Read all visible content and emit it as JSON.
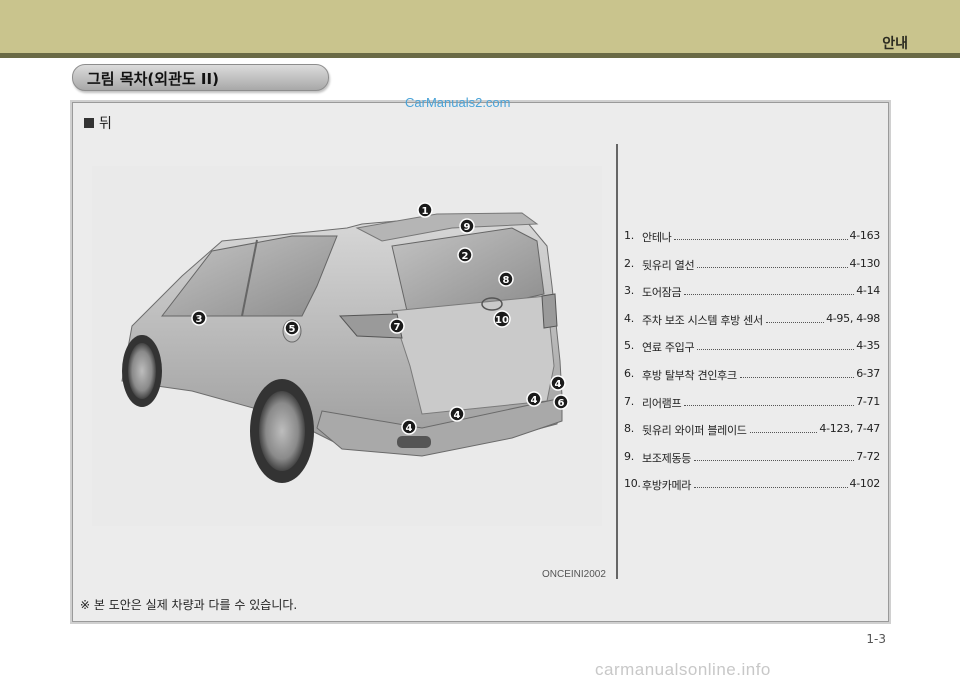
{
  "header": {
    "title": "안내"
  },
  "section": {
    "title": "그림 목차(외관도 II)"
  },
  "subsection": {
    "title": "뒤"
  },
  "watermark_top": "CarManuals2.com",
  "figure": {
    "image_code": "ONCEINI2002"
  },
  "callouts": [
    "1",
    "2",
    "3",
    "4",
    "4",
    "4",
    "4",
    "5",
    "6",
    "7",
    "8",
    "9",
    "10"
  ],
  "legend": [
    {
      "num": "1.",
      "name": "안테나",
      "page": "4-163"
    },
    {
      "num": "2.",
      "name": "뒷유리 열선",
      "page": "4-130"
    },
    {
      "num": "3.",
      "name": "도어잠금",
      "page": "4-14"
    },
    {
      "num": "4.",
      "name": "주차 보조 시스템 후방 센서",
      "page": "4-95, 4-98"
    },
    {
      "num": "5.",
      "name": "연료 주입구",
      "page": "4-35"
    },
    {
      "num": "6.",
      "name": "후방 탈부착 견인후크",
      "page": "6-37"
    },
    {
      "num": "7.",
      "name": "리어램프",
      "page": "7-71"
    },
    {
      "num": "8.",
      "name": "뒷유리 와이퍼 블레이드",
      "page": "4-123, 7-47"
    },
    {
      "num": "9.",
      "name": "보조제동등",
      "page": "7-72"
    },
    {
      "num": "10.",
      "name": "후방카메라",
      "page": "4-102"
    }
  ],
  "note": "※ 본 도안은 실제 차량과 다를 수 있습니다.",
  "page_number": "1-3",
  "watermark_bottom": "carmanualsonline.info"
}
